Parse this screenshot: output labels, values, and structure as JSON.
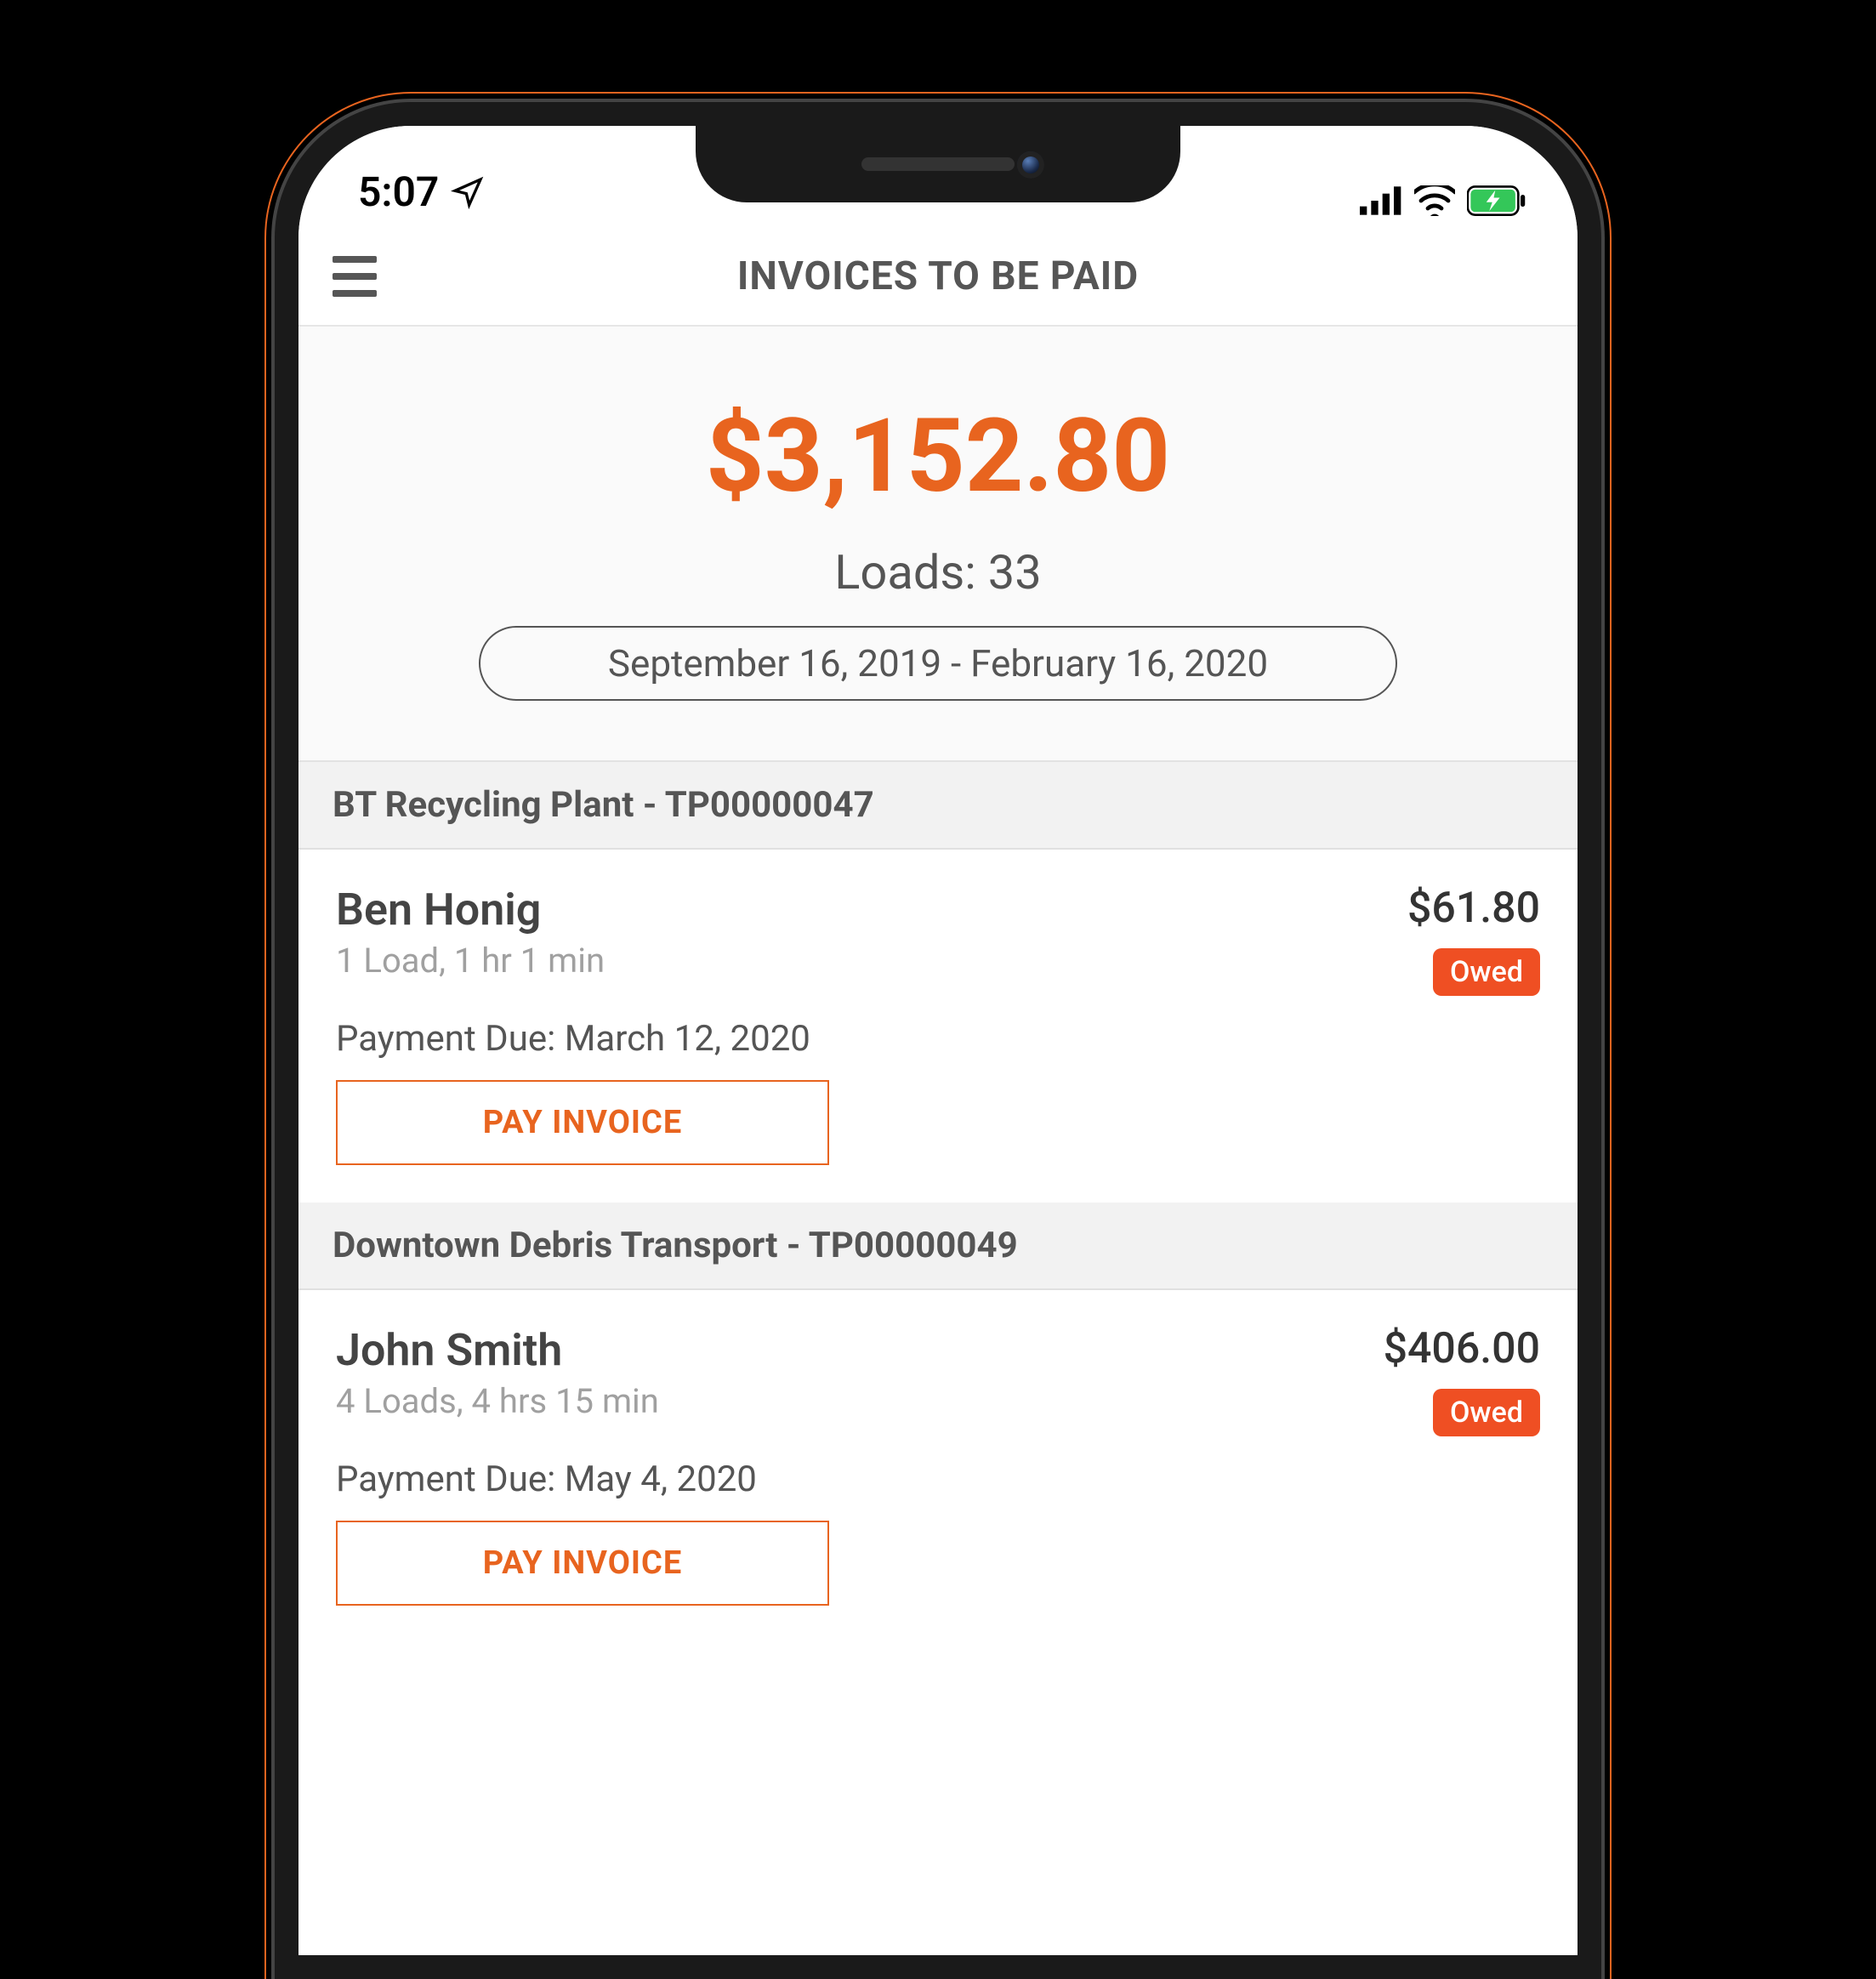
{
  "status": {
    "time": "5:07",
    "location_icon": "location-arrow-icon",
    "signal_icon": "cellular-signal-icon",
    "wifi_icon": "wifi-icon",
    "battery_icon": "battery-charging-icon"
  },
  "header": {
    "menu_icon": "hamburger-menu-icon",
    "title": "INVOICES TO BE PAID"
  },
  "summary": {
    "total": "$3,152.80",
    "loads_label": "Loads: 33",
    "date_range": "September 16, 2019 - February 16, 2020"
  },
  "sections": [
    {
      "title": "BT Recycling Plant - TP00000047",
      "invoice": {
        "name": "Ben Honig",
        "amount": "$61.80",
        "detail": "1 Load, 1 hr 1 min",
        "status": "Owed",
        "due_label": "Payment Due: March 12, 2020",
        "pay_label": "PAY INVOICE"
      }
    },
    {
      "title": "Downtown Debris Transport - TP00000049",
      "invoice": {
        "name": "John Smith",
        "amount": "$406.00",
        "detail": "4 Loads, 4 hrs 15 min",
        "status": "Owed",
        "due_label": "Payment Due: May 4, 2020",
        "pay_label": "PAY INVOICE"
      }
    }
  ],
  "colors": {
    "accent": "#e8641f",
    "badge": "#ef4f23"
  }
}
